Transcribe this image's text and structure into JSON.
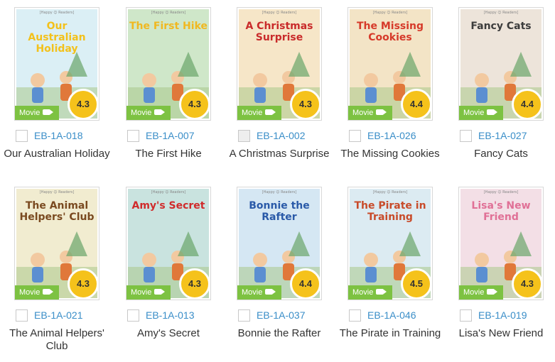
{
  "movie_label": "Movie",
  "books": [
    {
      "code": "EB-1A-018",
      "title": "Our Australian Holiday",
      "cover_title": "Our Australian Holiday",
      "series": "[Happy ☺ Readers]",
      "rating": "4.3",
      "bg": "#dbeff5",
      "title_color": "#f3c11b",
      "checkbox_grey": false
    },
    {
      "code": "EB-1A-007",
      "title": "The First Hike",
      "cover_title": "The First Hike",
      "series": "[Happy ☺ Readers]",
      "rating": "4.3",
      "bg": "#cfe7c9",
      "title_color": "#f0b820",
      "checkbox_grey": false
    },
    {
      "code": "EB-1A-002",
      "title": "A Christmas Surprise",
      "cover_title": "A Christmas Surprise",
      "series": "[Happy ☺ Readers]",
      "rating": "4.3",
      "bg": "#f6e6c8",
      "title_color": "#c92b2b",
      "checkbox_grey": true
    },
    {
      "code": "EB-1A-026",
      "title": "The Missing Cookies",
      "cover_title": "The Missing Cookies",
      "series": "[Happy ☺ Readers]",
      "rating": "4.4",
      "bg": "#f3e4c6",
      "title_color": "#d63a2a",
      "checkbox_grey": false
    },
    {
      "code": "EB-1A-027",
      "title": "Fancy Cats",
      "cover_title": "Fancy Cats",
      "series": "[Happy ☺ Readers]",
      "rating": "4.4",
      "bg": "#ede4da",
      "title_color": "#3c3c3c",
      "checkbox_grey": false
    },
    {
      "code": "EB-1A-021",
      "title": "The Animal Helpers' Club",
      "cover_title": "The Animal Helpers' Club",
      "series": "[Happy ☺ Readers]",
      "rating": "4.3",
      "bg": "#f1ecd0",
      "title_color": "#7a4a20",
      "checkbox_grey": false
    },
    {
      "code": "EB-1A-013",
      "title": "Amy's Secret",
      "cover_title": "Amy's Secret",
      "series": "[Happy ☺ Readers]",
      "rating": "4.3",
      "bg": "#c9e3df",
      "title_color": "#d02b2b",
      "checkbox_grey": false
    },
    {
      "code": "EB-1A-037",
      "title": "Bonnie the Rafter",
      "cover_title": "Bonnie the Rafter",
      "series": "[Happy ☺ Readers]",
      "rating": "4.4",
      "bg": "#d5e7f3",
      "title_color": "#2a5aa8",
      "checkbox_grey": false
    },
    {
      "code": "EB-1A-046",
      "title": "The Pirate in Training",
      "cover_title": "The Pirate in Training",
      "series": "[Happy ☺ Readers]",
      "rating": "4.5",
      "bg": "#dcebf2",
      "title_color": "#c84b2a",
      "checkbox_grey": false
    },
    {
      "code": "EB-1A-019",
      "title": "Lisa's New Friend",
      "cover_title": "Lisa's New Friend",
      "series": "[Happy ☺ Readers]",
      "rating": "4.3",
      "bg": "#f3dfe6",
      "title_color": "#e07096",
      "checkbox_grey": false
    }
  ]
}
